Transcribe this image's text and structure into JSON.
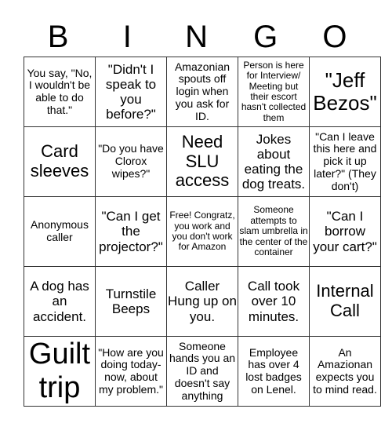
{
  "header": {
    "letters": [
      "B",
      "I",
      "N",
      "G",
      "O"
    ]
  },
  "rows": [
    [
      {
        "text": "You say, \"No, I wouldn't be able to do that.\"",
        "size": "s2"
      },
      {
        "text": "\"Didn't I speak to you before?\"",
        "size": "s3"
      },
      {
        "text": "Amazonian spouts off login when you ask for ID.",
        "size": "s2"
      },
      {
        "text": "Person is here for Interview/ Meeting but their escort hasn't collected them",
        "size": "s1"
      },
      {
        "text": "\"Jeff Bezos\"",
        "size": "s5"
      }
    ],
    [
      {
        "text": "Card sleeves",
        "size": "s4"
      },
      {
        "text": "\"Do you have Clorox wipes?\"",
        "size": "s2"
      },
      {
        "text": "Need SLU access",
        "size": "s4"
      },
      {
        "text": "Jokes about eating the dog treats.",
        "size": "s3"
      },
      {
        "text": "\"Can I leave this here and pick it up later?\" (They don't)",
        "size": "s2"
      }
    ],
    [
      {
        "text": "Anonymous caller",
        "size": "s2"
      },
      {
        "text": "\"Can I get the projector?\"",
        "size": "s3"
      },
      {
        "text": "Free! Congratz, you work and you don't work for Amazon",
        "size": "s1"
      },
      {
        "text": "Someone attempts to slam umbrella in the center of the container",
        "size": "s1"
      },
      {
        "text": "\"Can I borrow your cart?\"",
        "size": "s3"
      }
    ],
    [
      {
        "text": "A dog has an accident.",
        "size": "s3"
      },
      {
        "text": "Turnstile Beeps",
        "size": "s3"
      },
      {
        "text": "Caller Hung up on you.",
        "size": "s3"
      },
      {
        "text": "Call took over 10 minutes.",
        "size": "s3"
      },
      {
        "text": "Internal Call",
        "size": "s4"
      }
    ],
    [
      {
        "text": "Guilt trip",
        "size": "s6"
      },
      {
        "text": "\"How are you doing today- now, about my problem.\"",
        "size": "s2"
      },
      {
        "text": "Someone hands you an ID and doesn't say anything",
        "size": "s2"
      },
      {
        "text": "Employee has over 4 lost badges on Lenel.",
        "size": "s2"
      },
      {
        "text": "An Amazionan expects you to mind read.",
        "size": "s2"
      }
    ]
  ]
}
